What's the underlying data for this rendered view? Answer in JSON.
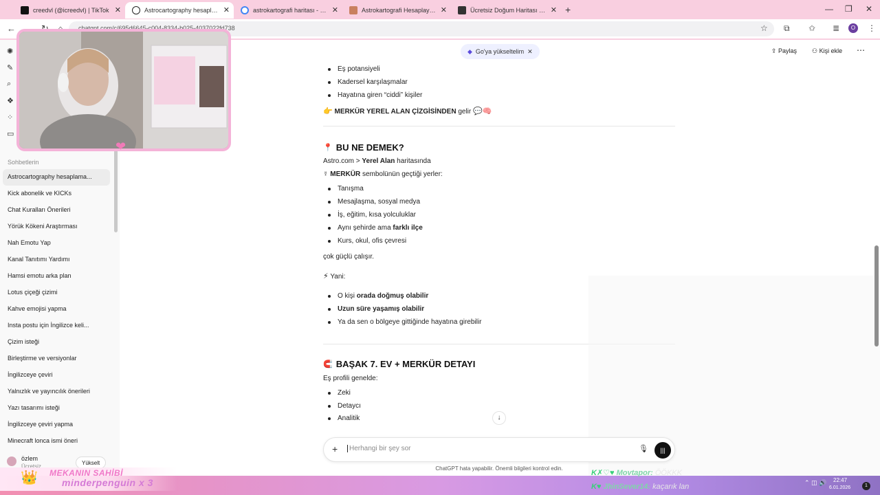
{
  "browser": {
    "tabs": [
      {
        "title": "creedvl (@icreedvl) | TikTok",
        "color": "#111111",
        "active": false
      },
      {
        "title": "Astrocartography hesaplama yardımı",
        "color": "#222222",
        "active": true
      },
      {
        "title": "astrokartografi haritası - Google",
        "color": "#4285f4",
        "active": false
      },
      {
        "title": "Astrokartografi Hesaplayıcı | Hesap",
        "color": "#c9805f",
        "active": false
      },
      {
        "title": "Ücretsiz Doğum Haritası Hesap",
        "color": "#333333",
        "active": false
      }
    ],
    "url": "chatgpt.com/c/695d6645-c004-8334-b025-4037022fd738"
  },
  "sidebar": {
    "section_label": "Sohbetlerin",
    "items": [
      "Astrocartography hesaplama...",
      "Kick abonelik ve KICKs",
      "Chat Kuralları Önerileri",
      "Yörük Kökeni Araştırması",
      "Nah Emotu Yap",
      "Kanal Tanıtımı Yardımı",
      "Hamsi emotu arka plan",
      "Lotus çiçeği çizimi",
      "Kahve emojisi yapma",
      "Insta postu için İngilizce keli...",
      "Çizim isteği",
      "Birleştirme ve versiyonlar",
      "İngilizceye çeviri",
      "Yalnızlık ve yayıncılık önerileri",
      "Yazı tasarımı isteği",
      "İngilizceye çeviri yapma",
      "Minecraft lonca ismi öneri"
    ],
    "user_name": "özlem",
    "user_plan": "Ücretsiz",
    "upgrade_label": "Yükselt"
  },
  "header": {
    "upgrade_pill": "Go'ya yükseltelim",
    "share": "Paylaş",
    "add_person": "Kişi ekle"
  },
  "message": {
    "top_list": [
      "Eş potansiyeli",
      "Kadersel karşılaşmalar",
      "Hayatına giren “ciddi” kişiler"
    ],
    "merkur_line_bold": "MERKÜR YEREL ALAN ÇİZGİSİNDEN",
    "merkur_line_rest": " gelir",
    "h1": "BU NE DEMEK?",
    "p1_pre": "Astro.com > ",
    "p1_bold": "Yerel Alan",
    "p1_post": " haritasında",
    "p2_sym": "☿ ",
    "p2_bold": "MERKÜR",
    "p2_post": " sembolünün geçtiği yerler:",
    "places": [
      "Tanışma",
      "Mesajlaşma, sosyal medya",
      "İş, eğitim, kısa yolculuklar",
      "Aynı şehirde ama ",
      "Kurs, okul, ofis çevresi"
    ],
    "places_bold_suffix": "farklı ilçe",
    "strong": "çok güçlü çalışır.",
    "yani": "Yani:",
    "yani_1_pre": "O kişi ",
    "yani_1_bold": "orada doğmuş olabilir",
    "yani_2_bold": "Uzun süre yaşamış olabilir",
    "yani_3": "Ya da sen o bölgeye gittiğinde hayatına girebilir",
    "h2": "BAŞAK 7. EV + MERKÜR DETAYI",
    "p3": "Eş profili genelde:",
    "traits": [
      "Zeki",
      "Detaycı",
      "Analitik"
    ]
  },
  "composer": {
    "placeholder": "Herhangi bir şey sor",
    "disclaimer": "ChatGPT hata yapabilir. Önemli bilgileri kontrol edin."
  },
  "stream": {
    "banner_title": "MEKANIN SAHİBİ",
    "banner_user": "minderpenguin x 3",
    "chat": [
      {
        "user": "Movtapor:",
        "msg": "ÖÖKKK"
      },
      {
        "user": "JhinSever14:",
        "msg": "kaçarık lan"
      }
    ],
    "time": "22:47",
    "date": "6.01.2026",
    "notif_count": "1"
  }
}
